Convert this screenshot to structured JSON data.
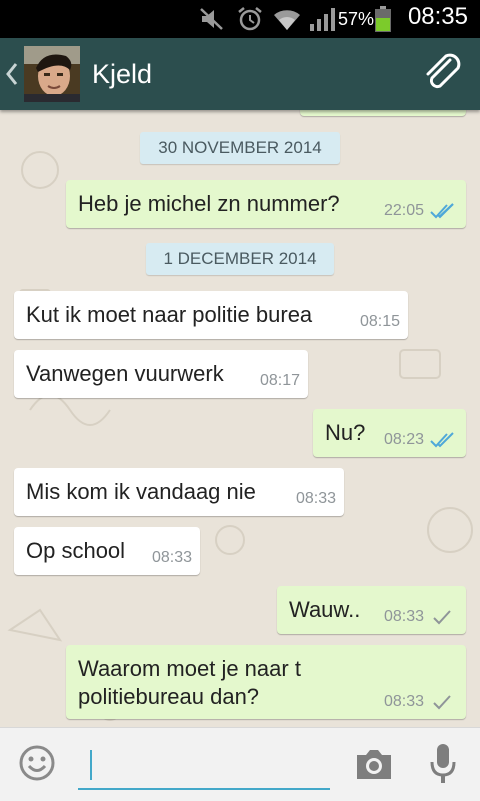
{
  "status_bar": {
    "battery": "57%",
    "time": "08:35",
    "icons": [
      "mute-icon",
      "alarm-icon",
      "wifi-icon",
      "signal-icon",
      "battery-icon"
    ]
  },
  "header": {
    "contact_name": "Kjeld",
    "icons": [
      "back-chevron-icon",
      "avatar",
      "attach-paperclip-icon"
    ],
    "color": "#2c4e4e"
  },
  "chat": {
    "date_separators": [
      "30 NOVEMBER 2014",
      "1 DECEMBER 2014"
    ],
    "messages": [
      {
        "text": "Heb je michel zn nummer?",
        "time": "22:05",
        "direction": "out",
        "status": "read"
      },
      {
        "text": "Kut ik moet naar politie burea",
        "time": "08:15",
        "direction": "in"
      },
      {
        "text": "Vanwegen vuurwerk",
        "time": "08:17",
        "direction": "in"
      },
      {
        "text": "Nu?",
        "time": "08:23",
        "direction": "out",
        "status": "read"
      },
      {
        "text": "Mis kom ik vandaag nie",
        "time": "08:33",
        "direction": "in"
      },
      {
        "text": "Op school",
        "time": "08:33",
        "direction": "in"
      },
      {
        "text": "Wauw..",
        "time": "08:33",
        "direction": "out",
        "status": "sent"
      },
      {
        "text_line1": "Waarom moet je naar t",
        "text_line2": "politiebureau dan?",
        "time": "08:33",
        "direction": "out",
        "status": "sent"
      }
    ],
    "colors": {
      "incoming": "#ffffff",
      "outgoing": "#e4f8cd",
      "read_tick": "#4fa8d9",
      "sent_tick": "#8f9599"
    }
  },
  "input_bar": {
    "icons": [
      "emoji-icon",
      "camera-icon",
      "microphone-icon"
    ],
    "accent": "#43a8c9"
  }
}
